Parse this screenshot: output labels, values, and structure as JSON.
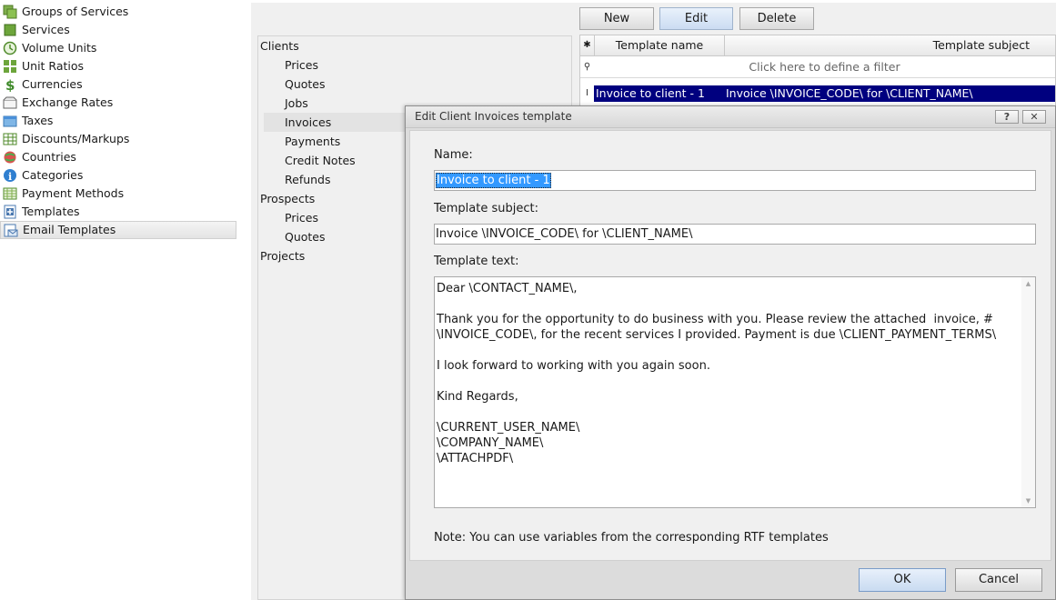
{
  "nav": {
    "items": [
      {
        "label": "Groups of Services",
        "icon": "groups-icon"
      },
      {
        "label": "Services",
        "icon": "services-icon"
      },
      {
        "label": "Volume Units",
        "icon": "volume-units-icon"
      },
      {
        "label": "Unit Ratios",
        "icon": "unit-ratios-icon"
      },
      {
        "label": "Currencies",
        "icon": "dollar-icon"
      },
      {
        "label": "Exchange Rates",
        "icon": "exchange-rates-icon"
      },
      {
        "label": "Taxes",
        "icon": "taxes-icon"
      },
      {
        "label": "Discounts/Markups",
        "icon": "table-icon"
      },
      {
        "label": "Countries",
        "icon": "globe-icon"
      },
      {
        "label": "Categories",
        "icon": "info-icon"
      },
      {
        "label": "Payment Methods",
        "icon": "payment-methods-icon"
      },
      {
        "label": "Templates",
        "icon": "templates-icon"
      },
      {
        "label": "Email Templates",
        "icon": "email-templates-icon"
      }
    ],
    "selected": "Email Templates"
  },
  "toolbar": {
    "new_label": "New",
    "edit_label": "Edit",
    "delete_label": "Delete"
  },
  "tree": {
    "items": [
      {
        "label": "Clients",
        "level": 0
      },
      {
        "label": "Prices",
        "level": 1
      },
      {
        "label": "Quotes",
        "level": 1
      },
      {
        "label": "Jobs",
        "level": 1
      },
      {
        "label": "Invoices",
        "level": 1
      },
      {
        "label": "Payments",
        "level": 1
      },
      {
        "label": "Credit Notes",
        "level": 1
      },
      {
        "label": "Refunds",
        "level": 1
      },
      {
        "label": "Prospects",
        "level": 0
      },
      {
        "label": "Prices",
        "level": 1
      },
      {
        "label": "Quotes",
        "level": 1
      },
      {
        "label": "Projects",
        "level": 0
      }
    ],
    "selected_index": 4
  },
  "grid": {
    "columns": [
      "Template name",
      "Template subject"
    ],
    "filter_hint": "Click here to define a filter",
    "header_marker": "✱",
    "filter_marker": "⚲",
    "row_marker": "I",
    "rows": [
      {
        "name": "Invoice to client - 1",
        "subject": "Invoice \\INVOICE_CODE\\ for \\CLIENT_NAME\\"
      }
    ]
  },
  "dialog": {
    "title": "Edit Client Invoices template",
    "help_label": "?",
    "close_label": "✕",
    "name_label": "Name:",
    "name_value": "Invoice to client - 1",
    "subject_label": "Template subject:",
    "subject_value": "Invoice \\INVOICE_CODE\\ for \\CLIENT_NAME\\",
    "text_label": "Template text:",
    "text_value": "Dear \\CONTACT_NAME\\,\n\nThank you for the opportunity to do business with you. Please review the attached  invoice, #\n\\INVOICE_CODE\\, for the recent services I provided. Payment is due \\CLIENT_PAYMENT_TERMS\\\n\nI look forward to working with you again soon.\n\nKind Regards,\n\n\\CURRENT_USER_NAME\\\n\\COMPANY_NAME\\\n\\ATTACHPDF\\",
    "note": "Note: You can use variables from the corresponding RTF templates",
    "ok_label": "OK",
    "cancel_label": "Cancel"
  },
  "colors": {
    "selection": "#00007f",
    "text_selection": "#3399ff",
    "workarea": "#f0f0f0"
  }
}
